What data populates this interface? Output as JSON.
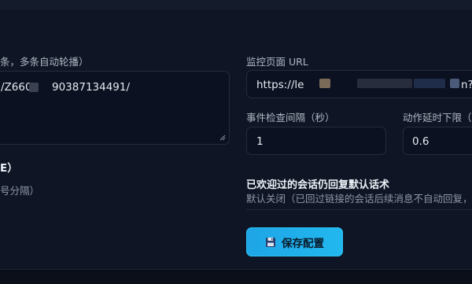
{
  "left": {
    "urls_label": "条，多条自动轮播）",
    "urls_value_a": "/Z6600",
    "urls_value_b": "90387134491/",
    "section_title_fragment": "E）",
    "section_desc_fragment": "号分隔）"
  },
  "right": {
    "monitor_url_label": "监控页面 URL",
    "monitor_url_value_start": "https://le",
    "monitor_url_value_end": "n?",
    "event_interval_label": "事件检查间隔（秒）",
    "event_interval_value": "1",
    "action_delay_label": "动作延时下限（",
    "action_delay_value": "0.6",
    "reply_default_title": "已欢迎过的会话仍回复默认话术",
    "reply_default_desc": "默认关闭（已回过链接的会话后续消息不自动回复，"
  },
  "actions": {
    "save_label": "保存配置",
    "save_icon": "floppy-disk-icon"
  },
  "colors": {
    "background": "#0d1220",
    "field_bg": "#0b1120",
    "accent": "#22b8ef"
  }
}
